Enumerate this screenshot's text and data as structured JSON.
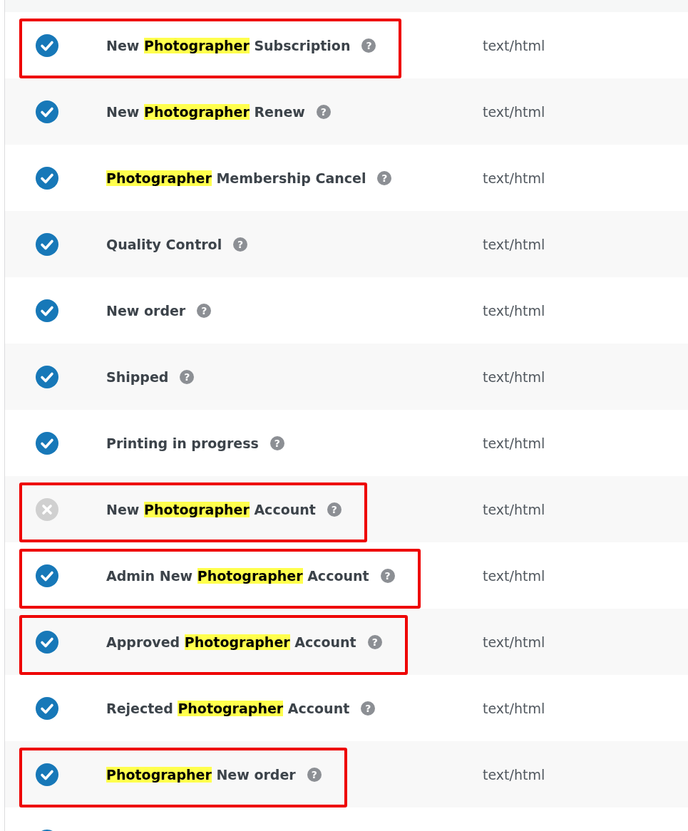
{
  "email_rows": [
    {
      "enabled": true,
      "annotated": true,
      "title": [
        {
          "text": "New "
        },
        {
          "text": "Photographer",
          "highlighted": true
        },
        {
          "text": " Subscription"
        }
      ],
      "help": "?",
      "content_type": "text/html"
    },
    {
      "enabled": true,
      "annotated": false,
      "title": [
        {
          "text": "New "
        },
        {
          "text": "Photographer",
          "highlighted": true
        },
        {
          "text": " Renew"
        }
      ],
      "help": "?",
      "content_type": "text/html"
    },
    {
      "enabled": true,
      "annotated": false,
      "title": [
        {
          "text": "Photographer",
          "highlighted": true
        },
        {
          "text": " Membership Cancel"
        }
      ],
      "help": "?",
      "content_type": "text/html"
    },
    {
      "enabled": true,
      "annotated": false,
      "title": [
        {
          "text": "Quality Control"
        }
      ],
      "help": "?",
      "content_type": "text/html"
    },
    {
      "enabled": true,
      "annotated": false,
      "title": [
        {
          "text": "New order"
        }
      ],
      "help": "?",
      "content_type": "text/html"
    },
    {
      "enabled": true,
      "annotated": false,
      "title": [
        {
          "text": "Shipped"
        }
      ],
      "help": "?",
      "content_type": "text/html"
    },
    {
      "enabled": true,
      "annotated": false,
      "title": [
        {
          "text": "Printing in progress"
        }
      ],
      "help": "?",
      "content_type": "text/html"
    },
    {
      "enabled": false,
      "annotated": true,
      "title": [
        {
          "text": "New "
        },
        {
          "text": "Photographer",
          "highlighted": true
        },
        {
          "text": " Account"
        }
      ],
      "help": "?",
      "content_type": "text/html"
    },
    {
      "enabled": true,
      "annotated": true,
      "title": [
        {
          "text": "Admin New "
        },
        {
          "text": "Photographer",
          "highlighted": true
        },
        {
          "text": " Account"
        }
      ],
      "help": "?",
      "content_type": "text/html"
    },
    {
      "enabled": true,
      "annotated": true,
      "title": [
        {
          "text": "Approved "
        },
        {
          "text": "Photographer",
          "highlighted": true
        },
        {
          "text": " Account"
        }
      ],
      "help": "?",
      "content_type": "text/html"
    },
    {
      "enabled": true,
      "annotated": false,
      "title": [
        {
          "text": "Rejected "
        },
        {
          "text": "Photographer",
          "highlighted": true
        },
        {
          "text": " Account"
        }
      ],
      "help": "?",
      "content_type": "text/html"
    },
    {
      "enabled": true,
      "annotated": true,
      "title": [
        {
          "text": "Photographer",
          "highlighted": true
        },
        {
          "text": " New order"
        }
      ],
      "help": "?",
      "content_type": "text/html"
    },
    {
      "enabled": true
    }
  ]
}
